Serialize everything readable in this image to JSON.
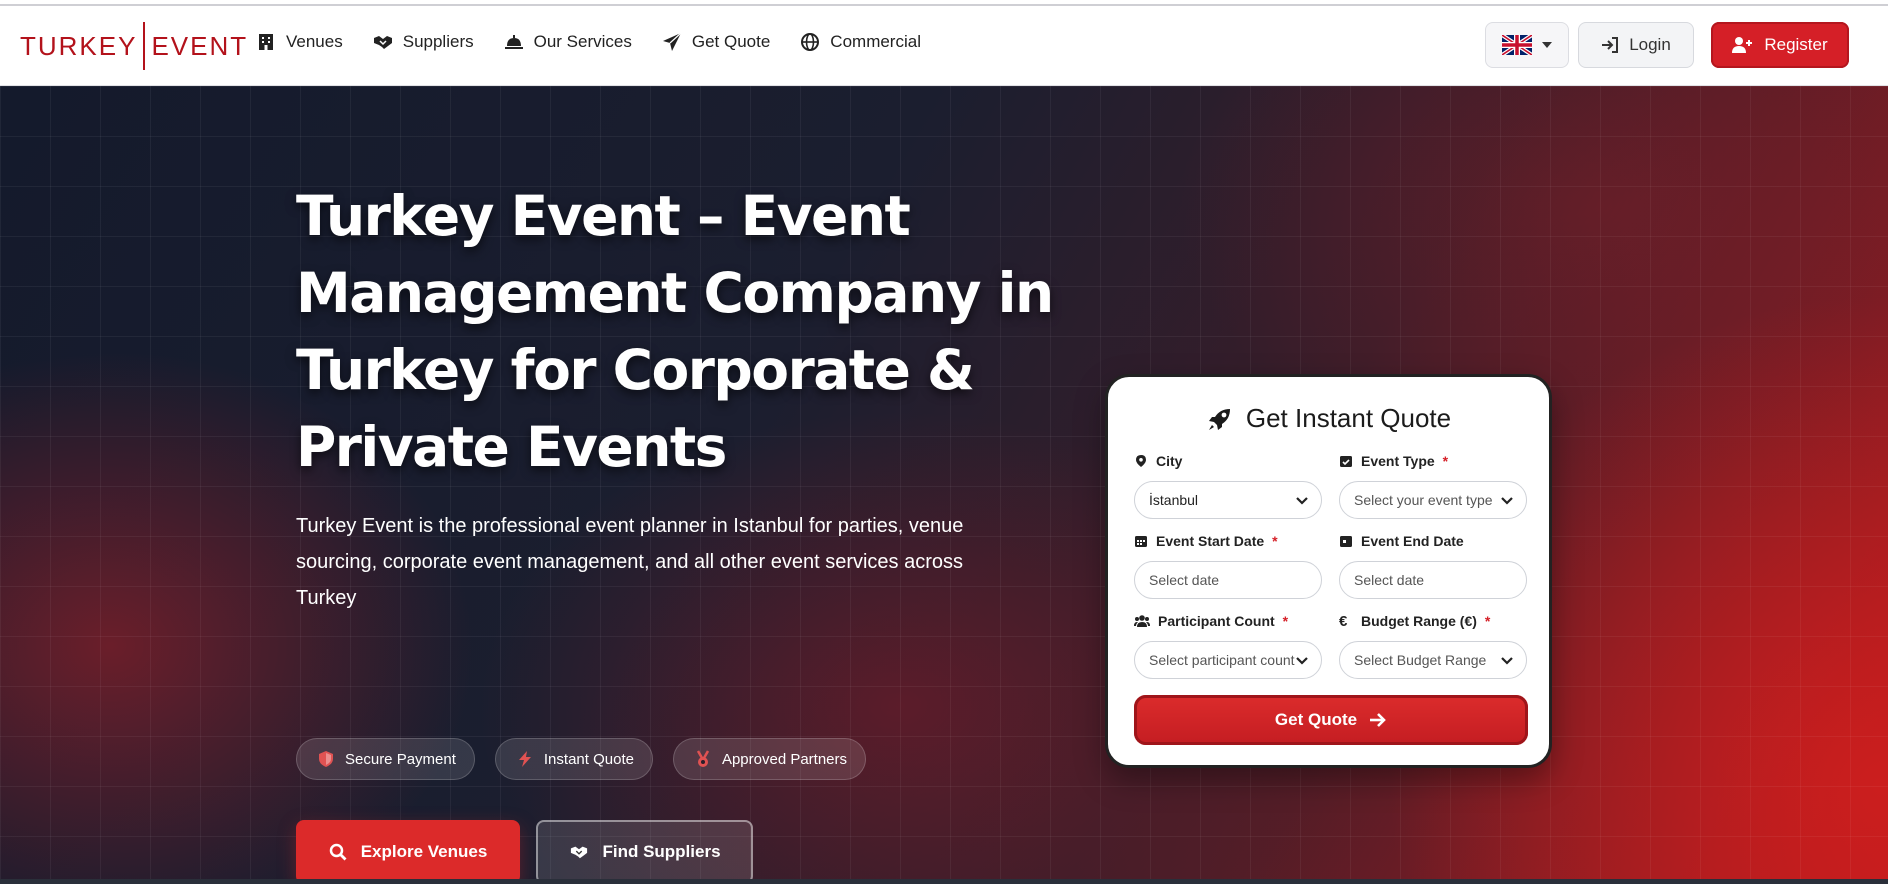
{
  "logo": {
    "left": "TURKEY",
    "right": "EVENT"
  },
  "nav": [
    {
      "label": "Venues",
      "icon": "building-icon"
    },
    {
      "label": "Suppliers",
      "icon": "handshake-icon"
    },
    {
      "label": "Our Services",
      "icon": "service-bell-icon"
    },
    {
      "label": "Get Quote",
      "icon": "paper-plane-icon"
    },
    {
      "label": "Commercial",
      "icon": "globe-icon"
    }
  ],
  "header_actions": {
    "language_flag": "uk-flag-icon",
    "login_label": "Login",
    "register_label": "Register"
  },
  "hero": {
    "title": "Turkey Event – Event Management Company in Turkey for Corporate & Private Events",
    "description": "Turkey Event is the professional event planner in Istanbul for parties, venue sourcing, corporate event management, and all other event services across Turkey",
    "badges": [
      {
        "label": "Secure Payment",
        "icon": "shield-icon"
      },
      {
        "label": "Instant Quote",
        "icon": "bolt-icon"
      },
      {
        "label": "Approved Partners",
        "icon": "medal-icon"
      }
    ],
    "cta_primary": "Explore Venues",
    "cta_secondary": "Find Suppliers"
  },
  "quote_form": {
    "title": "Get Instant Quote",
    "fields": {
      "city": {
        "label": "City",
        "value": "İstanbul",
        "required": false
      },
      "event_type": {
        "label": "Event Type",
        "value": "Select your event type",
        "required": true
      },
      "start_date": {
        "label": "Event Start Date",
        "placeholder": "Select date",
        "required": true
      },
      "end_date": {
        "label": "Event End Date",
        "placeholder": "Select date",
        "required": false
      },
      "participants": {
        "label": "Participant Count",
        "value": "Select participant count",
        "required": true
      },
      "budget": {
        "label": "Budget Range (€)",
        "value": "Select Budget Range",
        "required": true
      }
    },
    "submit_label": "Get Quote",
    "required_marker": "*"
  },
  "colors": {
    "brand_red": "#d51f27",
    "dark_navy": "#141a2c"
  }
}
